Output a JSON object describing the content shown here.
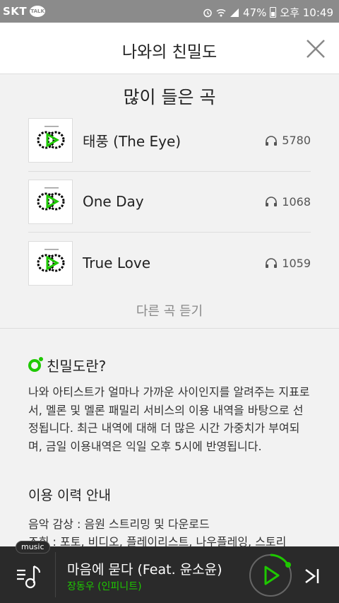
{
  "statusbar": {
    "carrier": "SKT",
    "talk_badge": "TALK",
    "battery": "47%",
    "time": "오후 10:49"
  },
  "header": {
    "title": "나와의 친밀도"
  },
  "top_songs": {
    "title": "많이 들은 곡",
    "items": [
      {
        "title": "태풍 (The Eye)",
        "plays": "5780"
      },
      {
        "title": "One Day",
        "plays": "1068"
      },
      {
        "title": "True Love",
        "plays": "1059"
      }
    ],
    "more_label": "다른 곡 듣기"
  },
  "intimacy": {
    "title": "친밀도란?",
    "description": "나와 아티스트가 얼마나 가까운 사이인지를 알려주는 지표로서, 멜론 및 멜론 패밀리 서비스의 이용 내역을 바탕으로 선정됩니다. 최근 내역에 대해 더 많은 시간 가중치가 부여되며, 금일 이용내역은 익일 오후 5시에 반영됩니다.",
    "history_title": "이용 이력 안내",
    "history_line1": "음악 감상 : 음원 스트리밍 및 다운로드",
    "history_line2": "조회 : 포토, 비디오, 플레이리스트, 나우플레잉, 스토리"
  },
  "player": {
    "tag": "music",
    "now_title": "마음에 묻다 (Feat. 윤소윤)",
    "now_artist": "장동우 (인피니트)"
  },
  "colors": {
    "accent": "#1ec800",
    "statusbar": "#8b8b8b",
    "player_bg": "#2a2a2a"
  }
}
